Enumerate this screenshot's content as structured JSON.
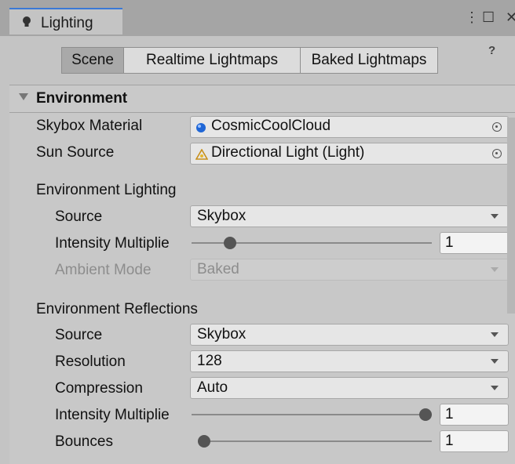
{
  "window": {
    "tab_title": "Lighting",
    "kebab_glyph": "⋮",
    "maximize_glyph": "☐",
    "close_glyph": "✕"
  },
  "mode_tabs": [
    {
      "label": "Scene",
      "active": true
    },
    {
      "label": "Realtime Lightmaps",
      "active": false
    },
    {
      "label": "Baked Lightmaps",
      "active": false
    }
  ],
  "help_glyph": "❷",
  "environment": {
    "header": "Environment",
    "skybox_material": {
      "label": "Skybox Material",
      "value": "CosmicCoolCloud",
      "icon": "material-sphere-icon"
    },
    "sun_source": {
      "label": "Sun Source",
      "value": "Directional Light (Light)",
      "icon": "directional-light-icon"
    },
    "lighting": {
      "heading": "Environment Lighting",
      "source": {
        "label": "Source",
        "value": "Skybox"
      },
      "intensity": {
        "label": "Intensity Multiplie",
        "value": "1",
        "slider_fraction": 0.14
      },
      "ambient_mode": {
        "label": "Ambient Mode",
        "value": "Baked",
        "disabled": true
      }
    },
    "reflections": {
      "heading": "Environment Reflections",
      "source": {
        "label": "Source",
        "value": "Skybox"
      },
      "resolution": {
        "label": "Resolution",
        "value": "128"
      },
      "compression": {
        "label": "Compression",
        "value": "Auto"
      },
      "intensity": {
        "label": "Intensity Multiplie",
        "value": "1",
        "slider_fraction": 1.0
      },
      "bounces": {
        "label": "Bounces",
        "value": "1",
        "slider_fraction": 0.0
      }
    }
  },
  "colors": {
    "accent": "#3a79d6",
    "panel_bg": "#c4c4c4",
    "field_bg": "#e6e6e6"
  }
}
